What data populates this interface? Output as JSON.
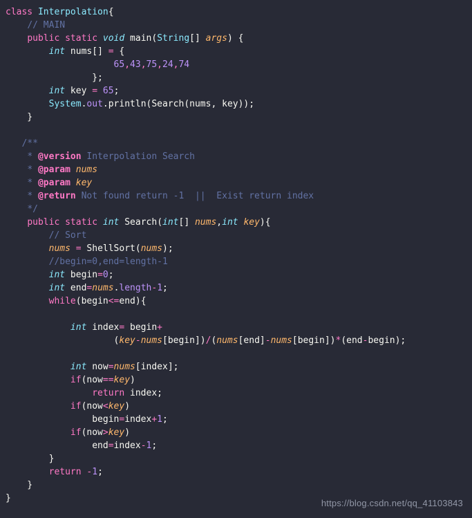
{
  "editor": {
    "background_color": "#282a36",
    "default_text_color": "#f8f8f2",
    "language": "java",
    "token_colors": {
      "keyword": "#ff79c6",
      "type": "#8be9fd",
      "class": "#8be9fd",
      "function": "#50fa7b",
      "param": "#ffb86c",
      "number": "#bd93f9",
      "field": "#bd93f9",
      "comment": "#6272a4",
      "doctag": "#ff79c6",
      "plain": "#f8f8f2",
      "operator": "#ff79c6"
    }
  },
  "watermark": {
    "text": "https://blog.csdn.net/qq_41103843",
    "color": "#9aa0b0"
  },
  "code": {
    "plain_text": "class Interpolation{\n    // MAIN\n    public static void main(String[] args) {\n        int nums[] = {\n                    65,43,75,24,74\n                };\n        int key = 65;\n        System.out.println(Search(nums, key));\n    }\n\n   /**\n    * @version Interpolation Search\n    * @param nums\n    * @param key\n    * @return Not found return -1  ||  Exist return index\n    */\n    public static int Search(int[] nums,int key){\n        // Sort\n        nums = ShellSort(nums);\n        //begin=0,end=length-1\n        int begin=0;\n        int end=nums.length-1;\n        while(begin<=end){\n\n            int index= begin+\n                    (key-nums[begin])/(nums[end]-nums[begin])*(end-begin);\n\n            int now=nums[index];\n            if(now==key)\n                return index;\n            if(now<key)\n                begin=index+1;\n            if(now>key)\n                end=index-1;\n        }\n        return -1;\n    }\n}",
    "lines": [
      {
        "tokens": [
          {
            "t": "class",
            "c": "keyword"
          },
          {
            "t": " ",
            "c": "plain"
          },
          {
            "t": "Interpolation",
            "c": "class"
          },
          {
            "t": "{",
            "c": "plain"
          }
        ]
      },
      {
        "tokens": [
          {
            "t": "    ",
            "c": "plain"
          },
          {
            "t": "// MAIN",
            "c": "comment"
          }
        ]
      },
      {
        "tokens": [
          {
            "t": "    ",
            "c": "plain"
          },
          {
            "t": "public",
            "c": "keyword"
          },
          {
            "t": " ",
            "c": "plain"
          },
          {
            "t": "static",
            "c": "keyword"
          },
          {
            "t": " ",
            "c": "plain"
          },
          {
            "t": "void",
            "c": "type"
          },
          {
            "t": " ",
            "c": "plain"
          },
          {
            "t": "main",
            "c": "function"
          },
          {
            "t": "(",
            "c": "plain"
          },
          {
            "t": "String",
            "c": "class"
          },
          {
            "t": "[] ",
            "c": "plain"
          },
          {
            "t": "args",
            "c": "param"
          },
          {
            "t": ") {",
            "c": "plain"
          }
        ]
      },
      {
        "tokens": [
          {
            "t": "        ",
            "c": "plain"
          },
          {
            "t": "int",
            "c": "type"
          },
          {
            "t": " nums[] ",
            "c": "plain"
          },
          {
            "t": "=",
            "c": "operator"
          },
          {
            "t": " {",
            "c": "plain"
          }
        ]
      },
      {
        "tokens": [
          {
            "t": "                    ",
            "c": "plain"
          },
          {
            "t": "65",
            "c": "number"
          },
          {
            "t": ",",
            "c": "operator"
          },
          {
            "t": "43",
            "c": "number"
          },
          {
            "t": ",",
            "c": "operator"
          },
          {
            "t": "75",
            "c": "number"
          },
          {
            "t": ",",
            "c": "operator"
          },
          {
            "t": "24",
            "c": "number"
          },
          {
            "t": ",",
            "c": "operator"
          },
          {
            "t": "74",
            "c": "number"
          }
        ]
      },
      {
        "tokens": [
          {
            "t": "                };",
            "c": "plain"
          }
        ]
      },
      {
        "tokens": [
          {
            "t": "        ",
            "c": "plain"
          },
          {
            "t": "int",
            "c": "type"
          },
          {
            "t": " key ",
            "c": "plain"
          },
          {
            "t": "=",
            "c": "operator"
          },
          {
            "t": " ",
            "c": "plain"
          },
          {
            "t": "65",
            "c": "number"
          },
          {
            "t": ";",
            "c": "plain"
          }
        ]
      },
      {
        "tokens": [
          {
            "t": "        ",
            "c": "plain"
          },
          {
            "t": "System",
            "c": "class"
          },
          {
            "t": ".",
            "c": "plain"
          },
          {
            "t": "out",
            "c": "field"
          },
          {
            "t": ".",
            "c": "plain"
          },
          {
            "t": "println",
            "c": "function"
          },
          {
            "t": "(",
            "c": "plain"
          },
          {
            "t": "Search",
            "c": "function"
          },
          {
            "t": "(nums, key));",
            "c": "plain"
          }
        ]
      },
      {
        "tokens": [
          {
            "t": "    }",
            "c": "plain"
          }
        ]
      },
      {
        "tokens": []
      },
      {
        "tokens": [
          {
            "t": "   ",
            "c": "plain"
          },
          {
            "t": "/**",
            "c": "comment"
          }
        ]
      },
      {
        "tokens": [
          {
            "t": "    ",
            "c": "plain"
          },
          {
            "t": "* ",
            "c": "comment"
          },
          {
            "t": "@version",
            "c": "doctag"
          },
          {
            "t": " Interpolation Search",
            "c": "comment"
          }
        ]
      },
      {
        "tokens": [
          {
            "t": "    ",
            "c": "plain"
          },
          {
            "t": "* ",
            "c": "comment"
          },
          {
            "t": "@param",
            "c": "doctag"
          },
          {
            "t": " ",
            "c": "comment"
          },
          {
            "t": "nums",
            "c": "param"
          }
        ]
      },
      {
        "tokens": [
          {
            "t": "    ",
            "c": "plain"
          },
          {
            "t": "* ",
            "c": "comment"
          },
          {
            "t": "@param",
            "c": "doctag"
          },
          {
            "t": " ",
            "c": "comment"
          },
          {
            "t": "key",
            "c": "param"
          }
        ]
      },
      {
        "tokens": [
          {
            "t": "    ",
            "c": "plain"
          },
          {
            "t": "* ",
            "c": "comment"
          },
          {
            "t": "@return",
            "c": "doctag"
          },
          {
            "t": " Not found return -1  ||  Exist return index",
            "c": "comment"
          }
        ]
      },
      {
        "tokens": [
          {
            "t": "    ",
            "c": "plain"
          },
          {
            "t": "*/",
            "c": "comment"
          }
        ]
      },
      {
        "tokens": [
          {
            "t": "    ",
            "c": "plain"
          },
          {
            "t": "public",
            "c": "keyword"
          },
          {
            "t": " ",
            "c": "plain"
          },
          {
            "t": "static",
            "c": "keyword"
          },
          {
            "t": " ",
            "c": "plain"
          },
          {
            "t": "int",
            "c": "type"
          },
          {
            "t": " ",
            "c": "plain"
          },
          {
            "t": "Search",
            "c": "function"
          },
          {
            "t": "(",
            "c": "plain"
          },
          {
            "t": "int",
            "c": "type"
          },
          {
            "t": "[] ",
            "c": "plain"
          },
          {
            "t": "nums",
            "c": "param"
          },
          {
            "t": ",",
            "c": "plain"
          },
          {
            "t": "int",
            "c": "type"
          },
          {
            "t": " ",
            "c": "plain"
          },
          {
            "t": "key",
            "c": "param"
          },
          {
            "t": "){",
            "c": "plain"
          }
        ]
      },
      {
        "tokens": [
          {
            "t": "        ",
            "c": "plain"
          },
          {
            "t": "// Sort",
            "c": "comment"
          }
        ]
      },
      {
        "tokens": [
          {
            "t": "        ",
            "c": "plain"
          },
          {
            "t": "nums",
            "c": "param"
          },
          {
            "t": " ",
            "c": "plain"
          },
          {
            "t": "=",
            "c": "operator"
          },
          {
            "t": " ",
            "c": "plain"
          },
          {
            "t": "ShellSort",
            "c": "function"
          },
          {
            "t": "(",
            "c": "plain"
          },
          {
            "t": "nums",
            "c": "param"
          },
          {
            "t": ");",
            "c": "plain"
          }
        ]
      },
      {
        "tokens": [
          {
            "t": "        ",
            "c": "plain"
          },
          {
            "t": "//begin=0,end=length-1",
            "c": "comment"
          }
        ]
      },
      {
        "tokens": [
          {
            "t": "        ",
            "c": "plain"
          },
          {
            "t": "int",
            "c": "type"
          },
          {
            "t": " begin",
            "c": "plain"
          },
          {
            "t": "=",
            "c": "operator"
          },
          {
            "t": "0",
            "c": "number"
          },
          {
            "t": ";",
            "c": "plain"
          }
        ]
      },
      {
        "tokens": [
          {
            "t": "        ",
            "c": "plain"
          },
          {
            "t": "int",
            "c": "type"
          },
          {
            "t": " end",
            "c": "plain"
          },
          {
            "t": "=",
            "c": "operator"
          },
          {
            "t": "nums",
            "c": "param"
          },
          {
            "t": ".",
            "c": "plain"
          },
          {
            "t": "length",
            "c": "field"
          },
          {
            "t": "-",
            "c": "operator"
          },
          {
            "t": "1",
            "c": "number"
          },
          {
            "t": ";",
            "c": "plain"
          }
        ]
      },
      {
        "tokens": [
          {
            "t": "        ",
            "c": "plain"
          },
          {
            "t": "while",
            "c": "keyword"
          },
          {
            "t": "(begin",
            "c": "plain"
          },
          {
            "t": "<=",
            "c": "operator"
          },
          {
            "t": "end){",
            "c": "plain"
          }
        ]
      },
      {
        "tokens": []
      },
      {
        "tokens": [
          {
            "t": "            ",
            "c": "plain"
          },
          {
            "t": "int",
            "c": "type"
          },
          {
            "t": " index",
            "c": "plain"
          },
          {
            "t": "=",
            "c": "operator"
          },
          {
            "t": " begin",
            "c": "plain"
          },
          {
            "t": "+",
            "c": "operator"
          }
        ]
      },
      {
        "tokens": [
          {
            "t": "                    (",
            "c": "plain"
          },
          {
            "t": "key",
            "c": "param"
          },
          {
            "t": "-",
            "c": "operator"
          },
          {
            "t": "nums",
            "c": "param"
          },
          {
            "t": "[begin])",
            "c": "plain"
          },
          {
            "t": "/",
            "c": "operator"
          },
          {
            "t": "(",
            "c": "plain"
          },
          {
            "t": "nums",
            "c": "param"
          },
          {
            "t": "[end]",
            "c": "plain"
          },
          {
            "t": "-",
            "c": "operator"
          },
          {
            "t": "nums",
            "c": "param"
          },
          {
            "t": "[begin])",
            "c": "plain"
          },
          {
            "t": "*",
            "c": "operator"
          },
          {
            "t": "(end",
            "c": "plain"
          },
          {
            "t": "-",
            "c": "operator"
          },
          {
            "t": "begin);",
            "c": "plain"
          }
        ]
      },
      {
        "tokens": []
      },
      {
        "tokens": [
          {
            "t": "            ",
            "c": "plain"
          },
          {
            "t": "int",
            "c": "type"
          },
          {
            "t": " now",
            "c": "plain"
          },
          {
            "t": "=",
            "c": "operator"
          },
          {
            "t": "nums",
            "c": "param"
          },
          {
            "t": "[index];",
            "c": "plain"
          }
        ]
      },
      {
        "tokens": [
          {
            "t": "            ",
            "c": "plain"
          },
          {
            "t": "if",
            "c": "keyword"
          },
          {
            "t": "(now",
            "c": "plain"
          },
          {
            "t": "==",
            "c": "operator"
          },
          {
            "t": "key",
            "c": "param"
          },
          {
            "t": ")",
            "c": "plain"
          }
        ]
      },
      {
        "tokens": [
          {
            "t": "                ",
            "c": "plain"
          },
          {
            "t": "return",
            "c": "keyword"
          },
          {
            "t": " index;",
            "c": "plain"
          }
        ]
      },
      {
        "tokens": [
          {
            "t": "            ",
            "c": "plain"
          },
          {
            "t": "if",
            "c": "keyword"
          },
          {
            "t": "(now",
            "c": "plain"
          },
          {
            "t": "<",
            "c": "operator"
          },
          {
            "t": "key",
            "c": "param"
          },
          {
            "t": ")",
            "c": "plain"
          }
        ]
      },
      {
        "tokens": [
          {
            "t": "                ",
            "c": "plain"
          },
          {
            "t": "begin",
            "c": "plain"
          },
          {
            "t": "=",
            "c": "operator"
          },
          {
            "t": "index",
            "c": "plain"
          },
          {
            "t": "+",
            "c": "operator"
          },
          {
            "t": "1",
            "c": "number"
          },
          {
            "t": ";",
            "c": "plain"
          }
        ]
      },
      {
        "tokens": [
          {
            "t": "            ",
            "c": "plain"
          },
          {
            "t": "if",
            "c": "keyword"
          },
          {
            "t": "(now",
            "c": "plain"
          },
          {
            "t": ">",
            "c": "operator"
          },
          {
            "t": "key",
            "c": "param"
          },
          {
            "t": ")",
            "c": "plain"
          }
        ]
      },
      {
        "tokens": [
          {
            "t": "                ",
            "c": "plain"
          },
          {
            "t": "end",
            "c": "plain"
          },
          {
            "t": "=",
            "c": "operator"
          },
          {
            "t": "index",
            "c": "plain"
          },
          {
            "t": "-",
            "c": "operator"
          },
          {
            "t": "1",
            "c": "number"
          },
          {
            "t": ";",
            "c": "plain"
          }
        ]
      },
      {
        "tokens": [
          {
            "t": "        }",
            "c": "plain"
          }
        ]
      },
      {
        "tokens": [
          {
            "t": "        ",
            "c": "plain"
          },
          {
            "t": "return",
            "c": "keyword"
          },
          {
            "t": " ",
            "c": "plain"
          },
          {
            "t": "-",
            "c": "operator"
          },
          {
            "t": "1",
            "c": "number"
          },
          {
            "t": ";",
            "c": "plain"
          }
        ]
      },
      {
        "tokens": [
          {
            "t": "    }",
            "c": "plain"
          }
        ]
      },
      {
        "tokens": [
          {
            "t": "}",
            "c": "plain"
          }
        ]
      }
    ]
  }
}
